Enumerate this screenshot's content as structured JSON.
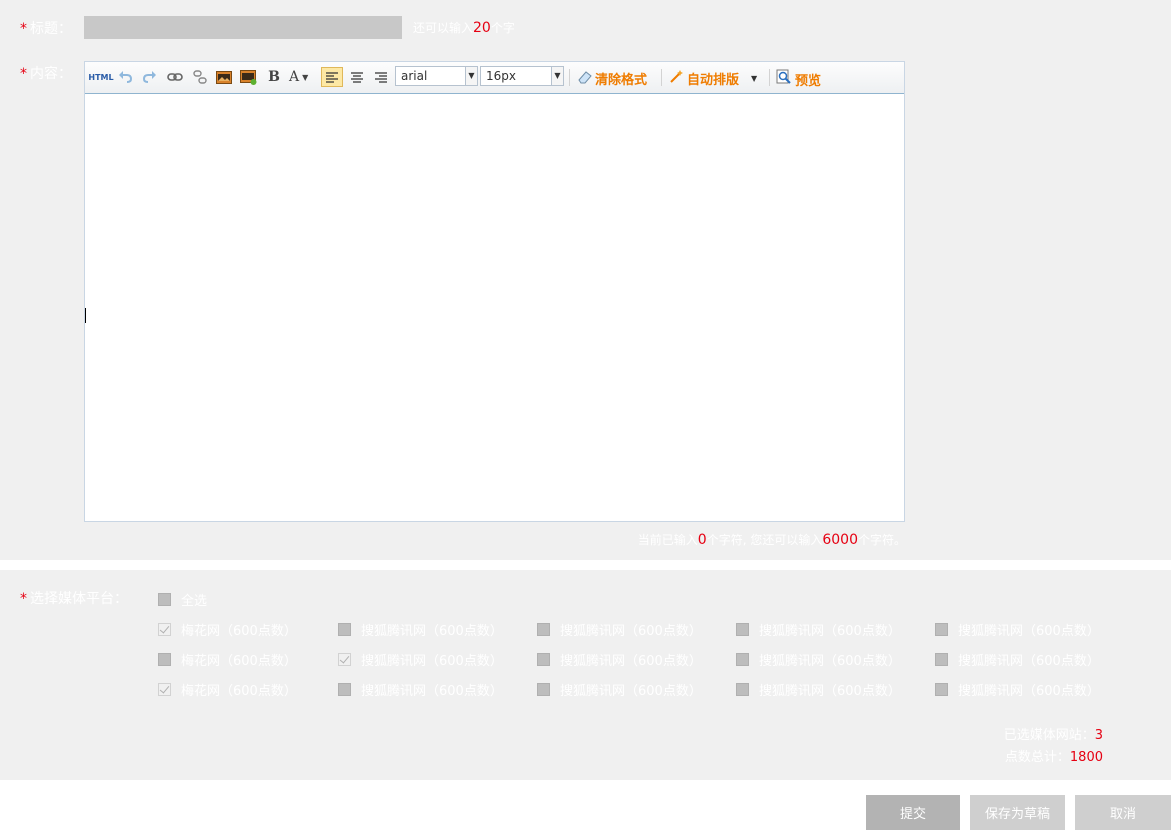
{
  "title_field": {
    "required_mark": "*",
    "label": "标题：",
    "value": "",
    "hint_prefix": "还可以输入",
    "hint_count": "20",
    "hint_suffix": "个字"
  },
  "content_field": {
    "required_mark": "*",
    "label": "内容："
  },
  "toolbar": {
    "font_family": "arial",
    "font_size": "16px",
    "clear_format": "清除格式",
    "auto_layout": "自动排版",
    "preview": "预览",
    "html_label": "HTML",
    "bold_label": "B",
    "fontcolor_label": "A",
    "icons": [
      "html-icon",
      "undo-icon",
      "redo-icon",
      "link-icon",
      "unlink-icon",
      "image-icon",
      "insert-image-icon",
      "bold-icon",
      "font-color-icon",
      "align-left-icon",
      "align-center-icon",
      "align-right-icon"
    ]
  },
  "char_count": {
    "prefix": "当前已输入",
    "current": "0",
    "middle": "个字符, 您还可以输入",
    "remaining": "6000",
    "suffix": "个字符。"
  },
  "media": {
    "required_mark": "*",
    "label": "选择媒体平台：",
    "select_all": "全选",
    "rows": [
      [
        {
          "label": "梅花网（600点数）",
          "checked": true
        },
        {
          "label": "搜狐腾讯网（600点数）",
          "checked": false
        },
        {
          "label": "搜狐腾讯网（600点数）",
          "checked": false
        },
        {
          "label": "搜狐腾讯网（600点数）",
          "checked": false
        },
        {
          "label": "搜狐腾讯网（600点数）",
          "checked": false
        }
      ],
      [
        {
          "label": "梅花网（600点数）",
          "checked": false
        },
        {
          "label": "搜狐腾讯网（600点数）",
          "checked": true
        },
        {
          "label": "搜狐腾讯网（600点数）",
          "checked": false
        },
        {
          "label": "搜狐腾讯网（600点数）",
          "checked": false
        },
        {
          "label": "搜狐腾讯网（600点数）",
          "checked": false
        }
      ],
      [
        {
          "label": "梅花网（600点数）",
          "checked": true
        },
        {
          "label": "搜狐腾讯网（600点数）",
          "checked": false
        },
        {
          "label": "搜狐腾讯网（600点数）",
          "checked": false
        },
        {
          "label": "搜狐腾讯网（600点数）",
          "checked": false
        },
        {
          "label": "搜狐腾讯网（600点数）",
          "checked": false
        }
      ]
    ]
  },
  "summary": {
    "selected_label": "已选媒体网站：",
    "selected_count": "3",
    "points_label": "点数总计：",
    "points_total": "1800"
  },
  "buttons": {
    "submit": "提交",
    "save_draft": "保存为草稿",
    "cancel": "取消"
  },
  "colors": {
    "accent_red": "#e60012",
    "orange": "#ef7c00",
    "panel_bg": "#f0f0f0",
    "button_gray": "#b3b3b3"
  }
}
